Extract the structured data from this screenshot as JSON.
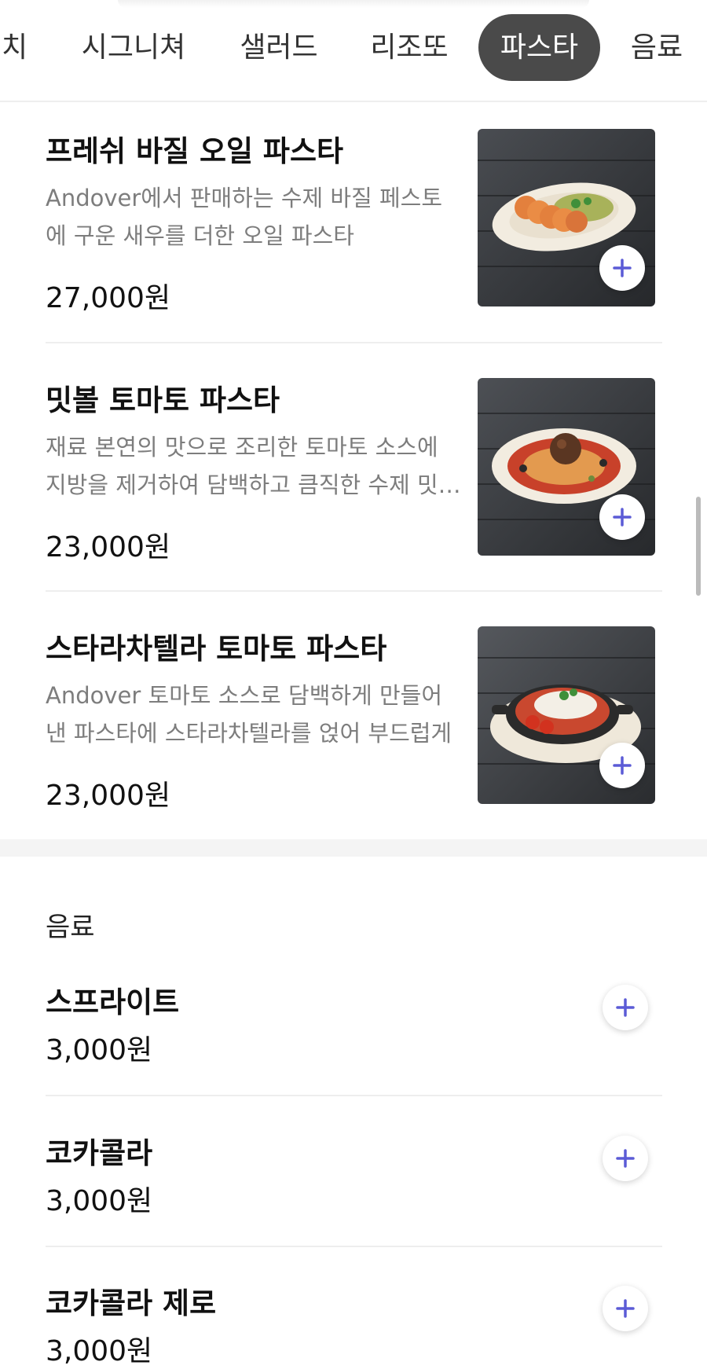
{
  "tabs": [
    {
      "label": "런치"
    },
    {
      "label": "시그니쳐"
    },
    {
      "label": "샐러드"
    },
    {
      "label": "리조또"
    },
    {
      "label": "파스타",
      "active": true
    },
    {
      "label": "음료"
    }
  ],
  "pasta_items": [
    {
      "name": "프레쉬 바질 오일 파스타",
      "description": "Andover에서 판매하는 수제 바질 페스토에 구운 새우를 더한 오일 파스타",
      "price": "27,000원"
    },
    {
      "name": "밋볼 토마토 파스타",
      "description": "재료 본연의 맛으로 조리한 토마토 소스에 지방을 제거하여 담백하고 큼직한 수제 밋볼을 올린 파스타",
      "price": "23,000원"
    },
    {
      "name": "스타라차텔라 토마토 파스타",
      "description": "Andover 토마토 소스로 담백하게 만들어낸 파스타에 스타라차텔라를 얹어 부드럽게",
      "price": "23,000원"
    }
  ],
  "drinks_section": {
    "title": "음료",
    "items": [
      {
        "name": "스프라이트",
        "price": "3,000원"
      },
      {
        "name": "코카콜라",
        "price": "3,000원"
      },
      {
        "name": "코카콜라 제로",
        "price": "3,000원"
      }
    ]
  },
  "colors": {
    "active_tab_bg": "#4a4a4a",
    "accent_plus": "#5b5bd6",
    "muted_text": "#7d7d7d"
  }
}
